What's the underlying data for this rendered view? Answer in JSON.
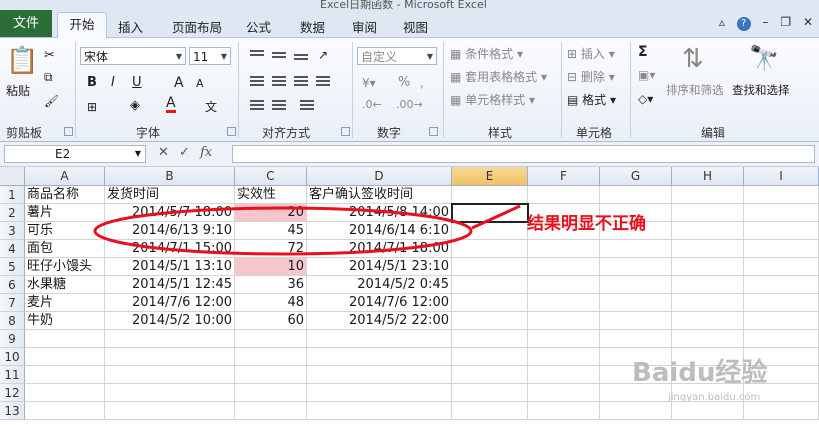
{
  "window": {
    "title": "Excel日期函数 - Microsoft Excel"
  },
  "tabs": [
    "文件",
    "开始",
    "插入",
    "页面布局",
    "公式",
    "数据",
    "审阅",
    "视图"
  ],
  "ribbon": {
    "clipboard": {
      "paste": "粘贴",
      "label": "剪贴板"
    },
    "font": {
      "name": "宋体",
      "size": "11",
      "bold": "B",
      "italic": "I",
      "underline": "U",
      "grow": "A",
      "shrink": "A",
      "color": "A",
      "label": "字体"
    },
    "alignment": {
      "label": "对齐方式"
    },
    "number": {
      "format": "自定义",
      "percent": "%",
      "label": "数字"
    },
    "styles": {
      "conditional": "条件格式",
      "table": "套用表格格式",
      "cell": "单元格样式",
      "label": "样式"
    },
    "cells": {
      "insert": "插入",
      "delete": "删除",
      "format": "格式",
      "label": "单元格"
    },
    "editing": {
      "sum": "Σ",
      "sort": "排序和筛选",
      "find": "查找和选择",
      "label": "编辑"
    }
  },
  "formula_bar": {
    "name_box": "E2",
    "fx": "fx",
    "formula": ""
  },
  "sheet": {
    "columns": [
      "A",
      "B",
      "C",
      "D",
      "E",
      "F",
      "G",
      "H",
      "I"
    ],
    "row_numbers": [
      "1",
      "2",
      "3",
      "4",
      "5",
      "6",
      "7",
      "8",
      "9",
      "10",
      "11",
      "12",
      "13"
    ],
    "headers": [
      "商品名称",
      "发货时间",
      "实效性",
      "客户确认签收时间"
    ],
    "rows": [
      [
        "薯片",
        "2014/5/7 18:00",
        "20",
        "2014/5/8 14:00"
      ],
      [
        "可乐",
        "2014/6/13 9:10",
        "45",
        "2014/6/14 6:10"
      ],
      [
        "面包",
        "2014/7/1 15:00",
        "72",
        "2014/7/1 18:00"
      ],
      [
        "旺仔小馒头",
        "2014/5/1 13:10",
        "10",
        "2014/5/1 23:10"
      ],
      [
        "水果糖",
        "2014/5/1 12:45",
        "36",
        "2014/5/2 0:45"
      ],
      [
        "麦片",
        "2014/7/6 12:00",
        "48",
        "2014/7/6 12:00"
      ],
      [
        "牛奶",
        "2014/5/2 10:00",
        "60",
        "2014/5/2 22:00"
      ]
    ],
    "active_cell": "E2"
  },
  "annotation": "结果明显不正确",
  "colors": {
    "annotation": "#e8101e",
    "highlight": "#f7c5cc",
    "file_tab": "#2b6d36"
  },
  "watermark": {
    "brand": "Baidu经验",
    "url": "jingyan.baidu.com"
  }
}
